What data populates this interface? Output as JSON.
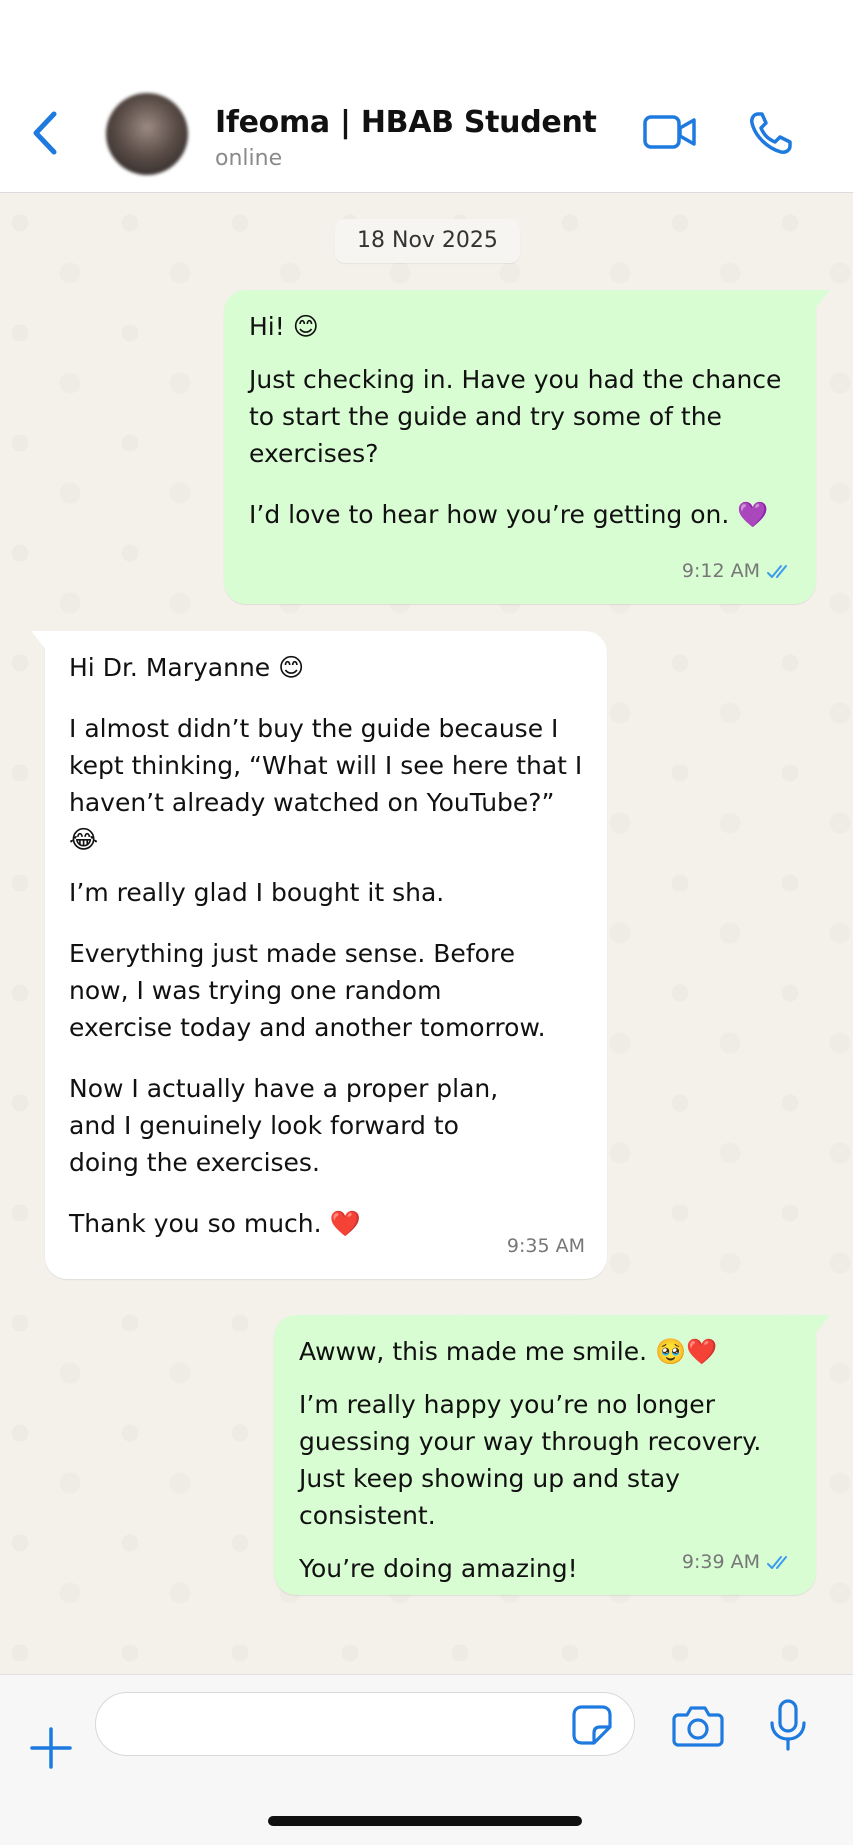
{
  "header": {
    "contact_name": "Ifeoma | HBAB Student",
    "status": "online"
  },
  "chat": {
    "date": "18 Nov 2025",
    "messages": [
      {
        "direction": "outgoing",
        "paragraphs": [
          "Hi! 😊",
          "Just checking in. Have you had the chance to start the guide and try some of the exercises?",
          "I’d love to hear how you’re getting on. 💜"
        ],
        "time": "9:12 AM",
        "read": true
      },
      {
        "direction": "incoming",
        "paragraphs": [
          "Hi Dr. Maryanne 😊",
          "I almost didn’t buy the guide because I kept thinking, “What will I see here that I haven’t already watched on YouTube?” 😂",
          "I’m really glad I bought it sha.",
          "Everything just made sense. Before now, I was trying one random exercise today and another tomorrow.",
          "Now I actually have a proper plan, and I genuinely look forward to doing the exercises.",
          "Thank you so much. ❤️"
        ],
        "time": "9:35 AM"
      },
      {
        "direction": "outgoing",
        "paragraphs": [
          "Awww, this made me smile. 🥹❤️",
          "I’m really happy you’re no longer guessing your way through recovery. Just keep showing up and stay consistent.",
          "You’re doing amazing!"
        ],
        "time": "9:39 AM",
        "read": true
      }
    ]
  },
  "input": {
    "placeholder": ""
  },
  "colors": {
    "accent": "#1f7ae0",
    "outgoing_bubble": "#d9fdd3",
    "incoming_bubble": "#ffffff",
    "chat_background": "#f4f0ea",
    "read_ticks": "#3a9bf0"
  },
  "icons": [
    "back-chevron-icon",
    "video-call-icon",
    "phone-icon",
    "plus-icon",
    "sticker-icon",
    "camera-icon",
    "microphone-icon",
    "double-check-icon"
  ]
}
